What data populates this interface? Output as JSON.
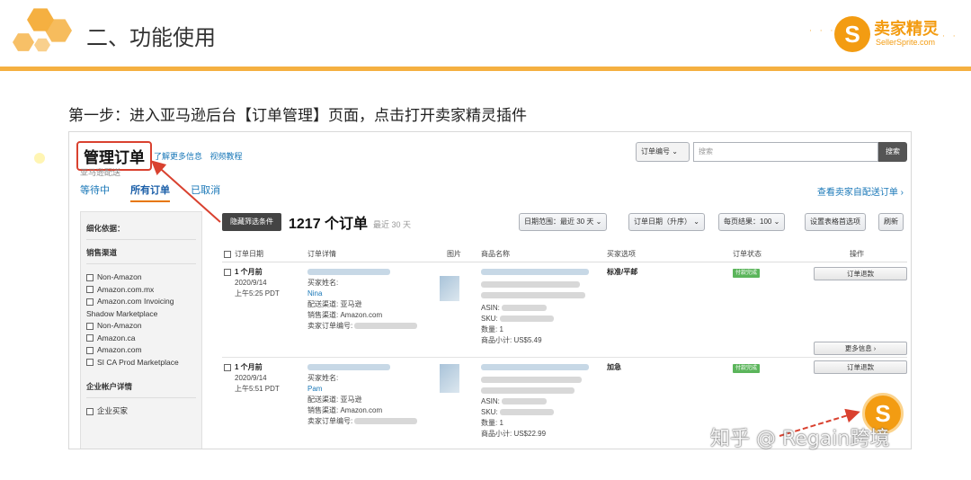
{
  "slide": {
    "title": "二、功能使用",
    "step_text": "第一步：进入亚马逊后台【订单管理】页面，点击打开卖家精灵插件",
    "brand_name": "卖家精灵",
    "brand_sub": "SellerSprite.com",
    "brand_letter": "S",
    "accent_color": "#f5b041",
    "watermark": "知乎 @ Regain跨境"
  },
  "amazon": {
    "page_title": "管理订单",
    "learn_more": "了解更多信息",
    "video_tutorial": "视频教程",
    "sub_label": "亚马逊配送",
    "tabs": [
      {
        "label": "等待中"
      },
      {
        "label": "所有订单",
        "active": true
      },
      {
        "label": "已取消"
      }
    ],
    "self_ship_link": "查看卖家自配送订单 ›",
    "search": {
      "select": "订单编号",
      "placeholder": "搜索",
      "button": "搜索"
    },
    "filters": {
      "heading1": "细化依据：",
      "heading2": "销售渠道",
      "channels": [
        "Non-Amazon",
        "Amazon.com.mx",
        "Amazon.com Invoicing Shadow Marketplace",
        "Non-Amazon",
        "Amazon.ca",
        "Amazon.com",
        "SI CA Prod Marketplace"
      ],
      "heading3": "企业帐户详情",
      "business": "企业买家"
    },
    "hide_filters_button": "隐藏筛选条件",
    "order_count": "1217 个订单",
    "order_range": "最近 30 天",
    "controls": {
      "date_range": "日期范围：最近 30 天",
      "order_date": "订单日期（升序）",
      "per_page": "每页结果：100",
      "table_prefs": "设置表格首选项",
      "refresh": "刷新"
    },
    "columns": [
      "订单日期",
      "订单详情",
      "图片",
      "商品名称",
      "买家选项",
      "订单状态",
      "操作"
    ],
    "rows": [
      {
        "ago": "1 个月前",
        "date": "2020/9/14",
        "time": "上午5:25 PDT",
        "buyer_label": "买家姓名:",
        "buyer": "Nina",
        "channel_label": "配送渠道: 亚马逊",
        "sales_channel": "销售渠道: Amazon.com",
        "seller_order": "卖家订单编号:",
        "asin": "ASIN:",
        "sku": "SKU:",
        "qty": "数量: 1",
        "subtotal": "商品小计: US$5.49",
        "shipping": "标准/平邮",
        "status": "付款完成",
        "action": "订单退款",
        "more": "更多信息 ›"
      },
      {
        "ago": "1 个月前",
        "date": "2020/9/14",
        "time": "上午5:51 PDT",
        "buyer_label": "买家姓名:",
        "buyer": "Pam",
        "channel_label": "配送渠道: 亚马逊",
        "sales_channel": "销售渠道: Amazon.com",
        "seller_order": "卖家订单编号:",
        "asin": "ASIN:",
        "sku": "SKU:",
        "qty": "数量: 1",
        "subtotal": "商品小计: US$22.99",
        "shipping": "加急",
        "status": "付款完成",
        "action": "订单退款"
      }
    ],
    "plugin_letter": "S"
  }
}
